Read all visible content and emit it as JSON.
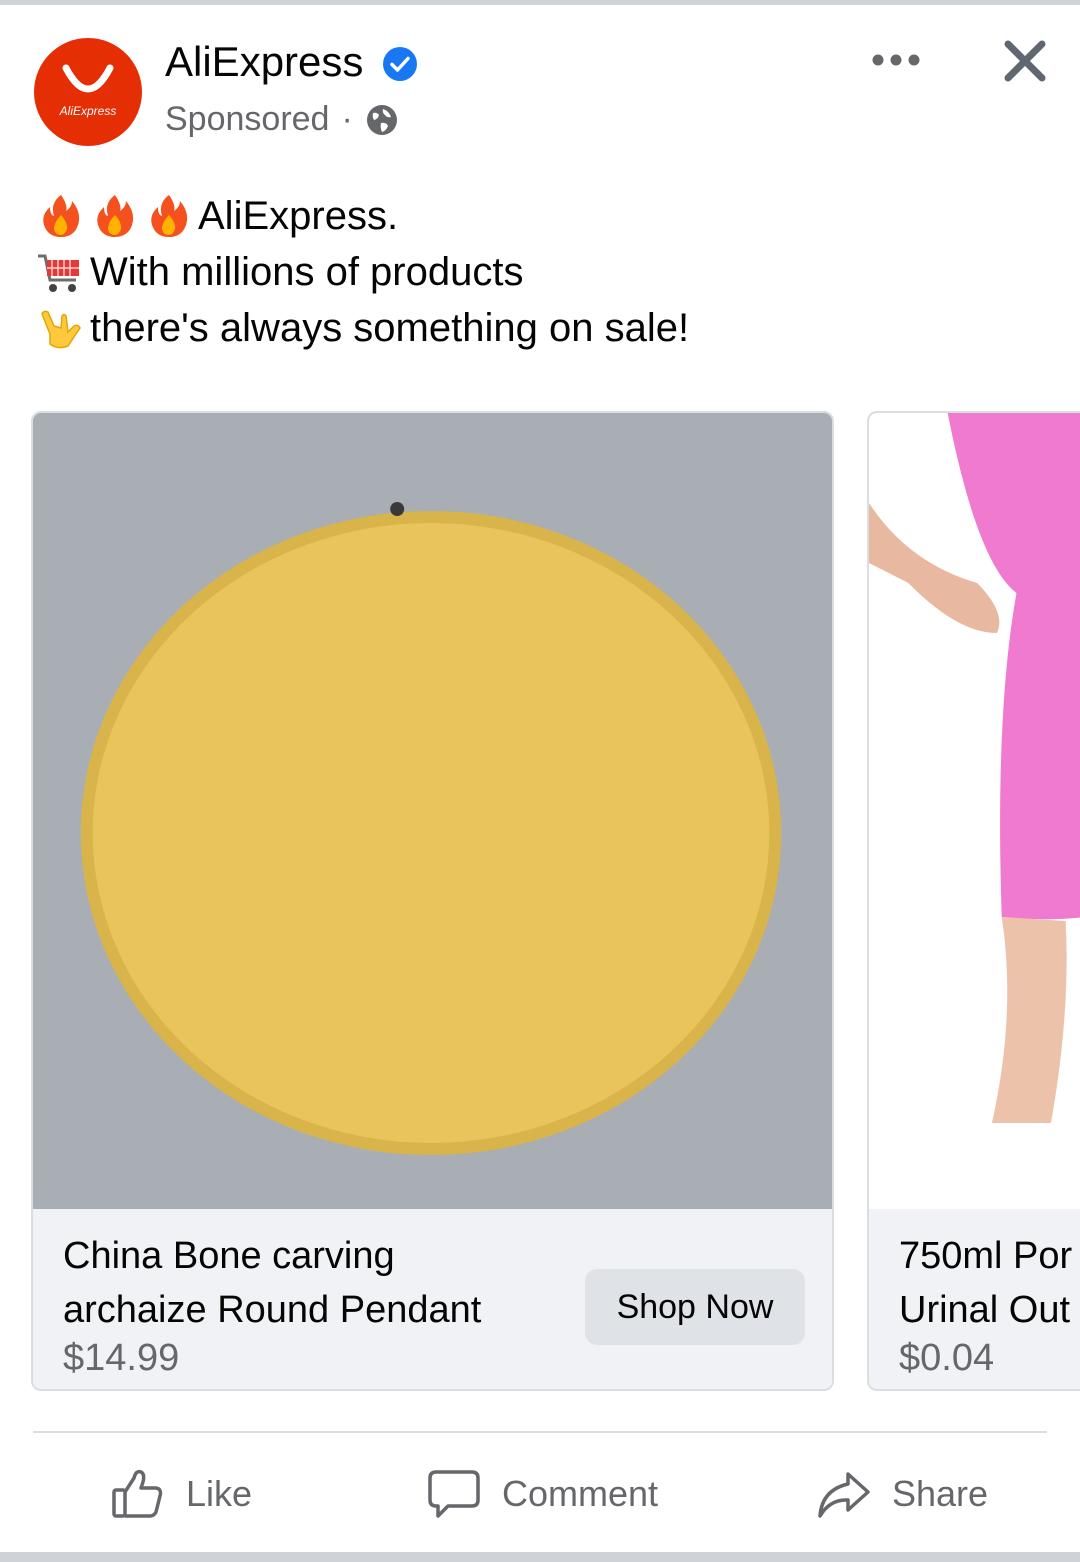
{
  "header": {
    "page_name": "AliExpress",
    "avatar_text": "AliExpress",
    "sponsored_label": "Sponsored",
    "separator": "·",
    "icons": [
      "verified-badge-icon",
      "globe-icon",
      "more-options-icon",
      "close-icon"
    ]
  },
  "post": {
    "lines": [
      {
        "emoji": "fire",
        "text": "AliExpress."
      },
      {
        "emoji": "shopping-cart",
        "text": "With millions of products"
      },
      {
        "emoji": "love-you-gesture",
        "text": "there's always something on sale!"
      }
    ]
  },
  "carousel": {
    "cards": [
      {
        "title_line1": "China Bone carving",
        "title_line2": "archaize Round Pendant",
        "price": "$14.99",
        "cta": "Shop Now"
      },
      {
        "title_line1": "750ml Por",
        "title_line2": "Urinal Out",
        "price": "$0.04"
      }
    ]
  },
  "actions": {
    "like": "Like",
    "comment": "Comment",
    "share": "Share"
  },
  "colors": {
    "brand_red": "#e62e04",
    "verified_blue": "#1877f2",
    "secondary_text": "#65676b",
    "card_background": "#f0f2f5",
    "button_background": "#dfe2e6"
  }
}
